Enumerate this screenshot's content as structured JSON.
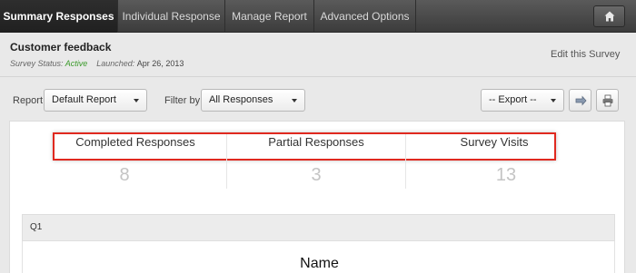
{
  "nav": {
    "tabs": [
      {
        "label": "Summary Responses",
        "active": true
      },
      {
        "label": "Individual Response",
        "active": false
      },
      {
        "label": "Manage Report",
        "active": false
      },
      {
        "label": "Advanced Options",
        "active": false
      }
    ],
    "home_icon": "home-icon"
  },
  "header": {
    "title": "Customer feedback",
    "status_label": "Survey Status:",
    "status_value": "Active",
    "launched_label": "Launched:",
    "launched_value": "Apr 26, 2013",
    "edit_link": "Edit this Survey"
  },
  "filters": {
    "report_label": "Report",
    "report_value": "Default Report",
    "filter_label": "Filter by",
    "filter_value": "All Responses",
    "export_value": "-- Export --",
    "share_icon": "share-icon",
    "print_icon": "printer-icon"
  },
  "stats": [
    {
      "label": "Completed Responses",
      "value": "8"
    },
    {
      "label": "Partial Responses",
      "value": "3"
    },
    {
      "label": "Survey Visits",
      "value": "13"
    }
  ],
  "question": {
    "label": "Q1",
    "name": "Name"
  },
  "colors": {
    "highlight": "#e0291f",
    "active_status": "#3a9a2a",
    "nav_bg": "#4a4a4a"
  }
}
